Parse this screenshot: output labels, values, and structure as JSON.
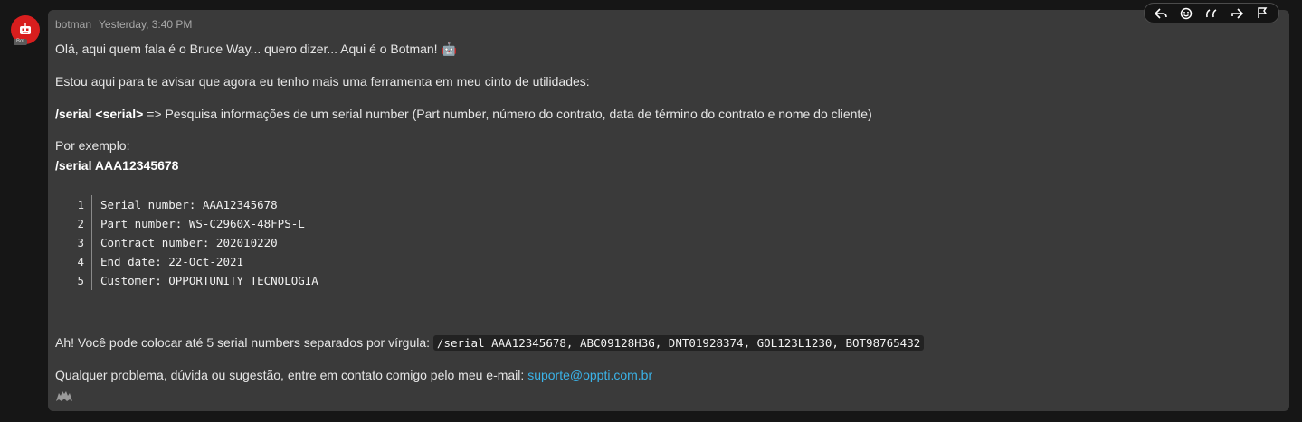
{
  "message": {
    "author": "botman",
    "timestamp": "Yesterday, 3:40 PM",
    "bot_tag": "Bot",
    "greeting": "Olá, aqui quem fala é o Bruce Way... quero dizer... Aqui é o Botman! 🤖",
    "intro": "Estou aqui para te avisar que agora eu tenho mais uma ferramenta em meu cinto de utilidades:",
    "command": "/serial",
    "command_arg": "<serial>",
    "command_desc": " => Pesquisa informações de um serial number (Part number, número do contrato, data de término do contrato e nome do cliente)",
    "example_label": "Por exemplo:",
    "example_command": "/serial AAA12345678",
    "code_lines": [
      {
        "n": "1",
        "text": "Serial number: AAA12345678"
      },
      {
        "n": "2",
        "text": "Part number: WS-C2960X-48FPS-L"
      },
      {
        "n": "3",
        "text": "Contract number: 202010220"
      },
      {
        "n": "4",
        "text": "End date: 22-Oct-2021"
      },
      {
        "n": "5",
        "text": "Customer: OPPORTUNITY TECNOLOGIA"
      }
    ],
    "multi_text": "Ah! Você pode colocar até 5 serial numbers separados por vírgula: ",
    "multi_code": "/serial AAA12345678, ABC09128H3G, DNT01928374, GOL123L1230, BOT98765432",
    "contact_text": "Qualquer problema, dúvida ou sugestão, entre em contato comigo pelo meu e-mail: ",
    "contact_email": "suporte@oppti.com.br"
  },
  "actions": [
    {
      "name": "reply-icon"
    },
    {
      "name": "emoji-icon"
    },
    {
      "name": "quote-icon"
    },
    {
      "name": "forward-icon"
    },
    {
      "name": "flag-icon"
    }
  ],
  "colors": {
    "background": "#161616",
    "card": "#3a3a3a",
    "link": "#3bb3e8",
    "avatar": "#d81e1e"
  }
}
